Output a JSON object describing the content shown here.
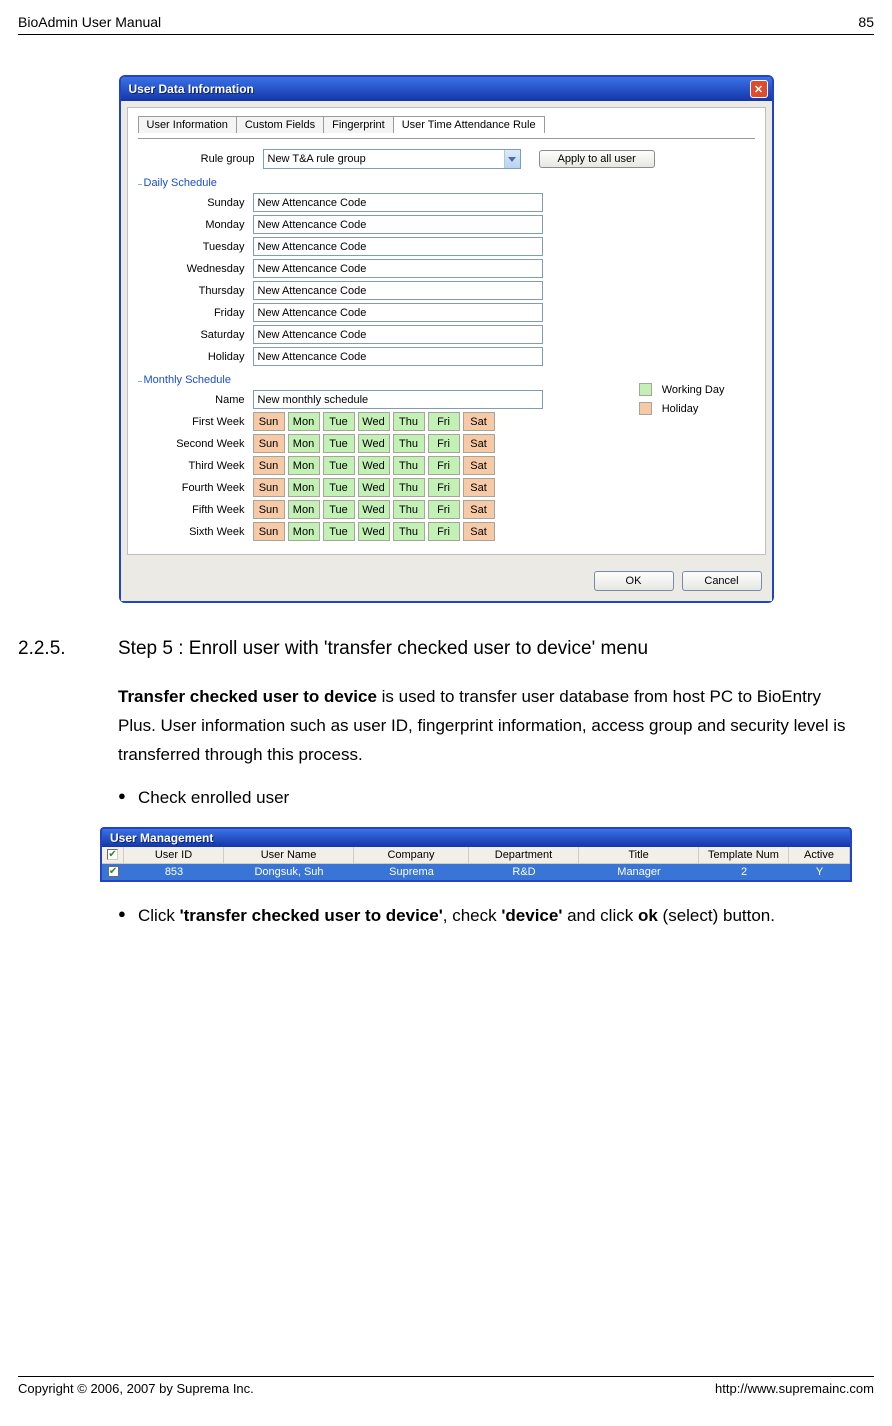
{
  "header": {
    "title": "BioAdmin User Manual",
    "page": "85"
  },
  "footer": {
    "left": "Copyright © 2006, 2007 by Suprema Inc.",
    "right": "http://www.supremainc.com"
  },
  "dialog": {
    "title": "User Data Information",
    "tabs": [
      "User Information",
      "Custom Fields",
      "Fingerprint",
      "User Time Attendance Rule"
    ],
    "active_tab": 3,
    "rule_group_label": "Rule group",
    "rule_group_value": "New T&A rule group",
    "apply_button": "Apply to all user",
    "daily_schedule_label": "Daily Schedule",
    "daily": {
      "days": [
        "Sunday",
        "Monday",
        "Tuesday",
        "Wednesday",
        "Thursday",
        "Friday",
        "Saturday",
        "Holiday"
      ],
      "value": "New Attencance Code"
    },
    "monthly_schedule_label": "Monthly Schedule",
    "monthly_name_label": "Name",
    "monthly_name_value": "New monthly schedule",
    "week_labels": [
      "First Week",
      "Second Week",
      "Third Week",
      "Fourth Week",
      "Fifth Week",
      "Sixth Week"
    ],
    "day_abbr": [
      "Sun",
      "Mon",
      "Tue",
      "Wed",
      "Thu",
      "Fri",
      "Sat"
    ],
    "day_types": [
      "holiday",
      "work",
      "work",
      "work",
      "work",
      "work",
      "holiday"
    ],
    "legend_working": "Working Day",
    "legend_holiday": "Holiday",
    "ok": "OK",
    "cancel": "Cancel"
  },
  "section": {
    "number": "2.2.5.",
    "title": "Step 5 : Enroll user with 'transfer checked user to device' menu"
  },
  "para1_a": "Transfer checked user to device",
  "para1_b": " is used to transfer user database from host PC to BioEntry Plus. User information such as user ID, fingerprint information, access group and security level is transferred through this process.",
  "bullet_check": "Check enrolled user",
  "bullet2_a": "Click ",
  "bullet2_b": "'transfer checked user to device'",
  "bullet2_c": ", check ",
  "bullet2_d": "'device'",
  "bullet2_e": " and click ",
  "bullet2_f": "ok",
  "bullet2_g": " (select) button.",
  "um": {
    "title": "User Management",
    "columns": [
      "User ID",
      "User Name",
      "Company",
      "Department",
      "Title",
      "Template Num",
      "Active"
    ],
    "row": [
      "853",
      "Dongsuk, Suh",
      "Suprema",
      "R&D",
      "Manager",
      "2",
      "Y"
    ]
  }
}
